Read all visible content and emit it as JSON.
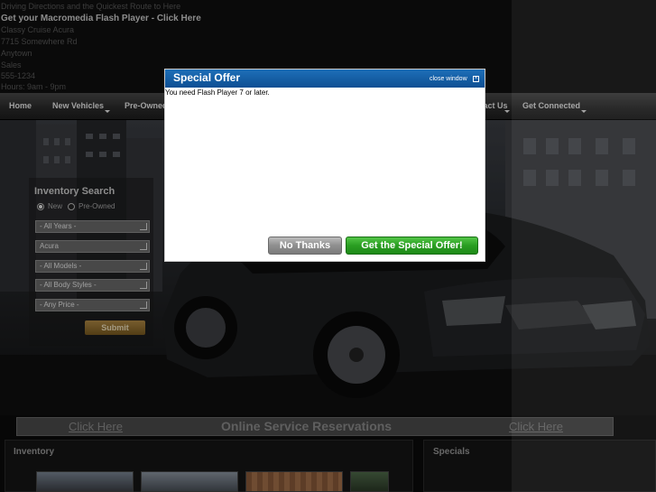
{
  "top": {
    "line1": "Driving Directions and the Quickest Route to Here",
    "flash_link": "Get your Macromedia Flash Player - Click Here",
    "line3": "Classy Cruise Acura",
    "line4": "7715 Somewhere Rd",
    "line5": "Anytown",
    "line6": "Sales",
    "line7": "555-1234",
    "line8": "Hours: 9am - 9pm"
  },
  "nav": {
    "items": [
      "Home",
      "New Vehicles",
      "Pre-Owned",
      "Contact Us",
      "Get Connected"
    ]
  },
  "inventory_search": {
    "title": "Inventory Search",
    "radio_new": "New",
    "radio_preowned": "Pre-Owned",
    "selects": [
      "- All Years -",
      "Acura",
      "- All Models -",
      "- All Body Styles -",
      "- Any Price -"
    ],
    "submit": "Submit"
  },
  "service": {
    "left_link": "Click Here",
    "title": "Online Service Reservations",
    "right_link": "Click Here"
  },
  "bottom": {
    "inventory_title": "Inventory",
    "specials_title": "Specials"
  },
  "modal": {
    "title": "Special Offer",
    "close_label": "close window",
    "message": "You need Flash Player 7 or later.",
    "no_thanks": "No Thanks",
    "offer_button": "Get the Special Offer!"
  },
  "colors": {
    "modal_header": "#1a64ad",
    "offer_green": "#2a9e22",
    "no_thanks_gray": "#8f8f8f",
    "submit_gold": "#9a7638"
  }
}
